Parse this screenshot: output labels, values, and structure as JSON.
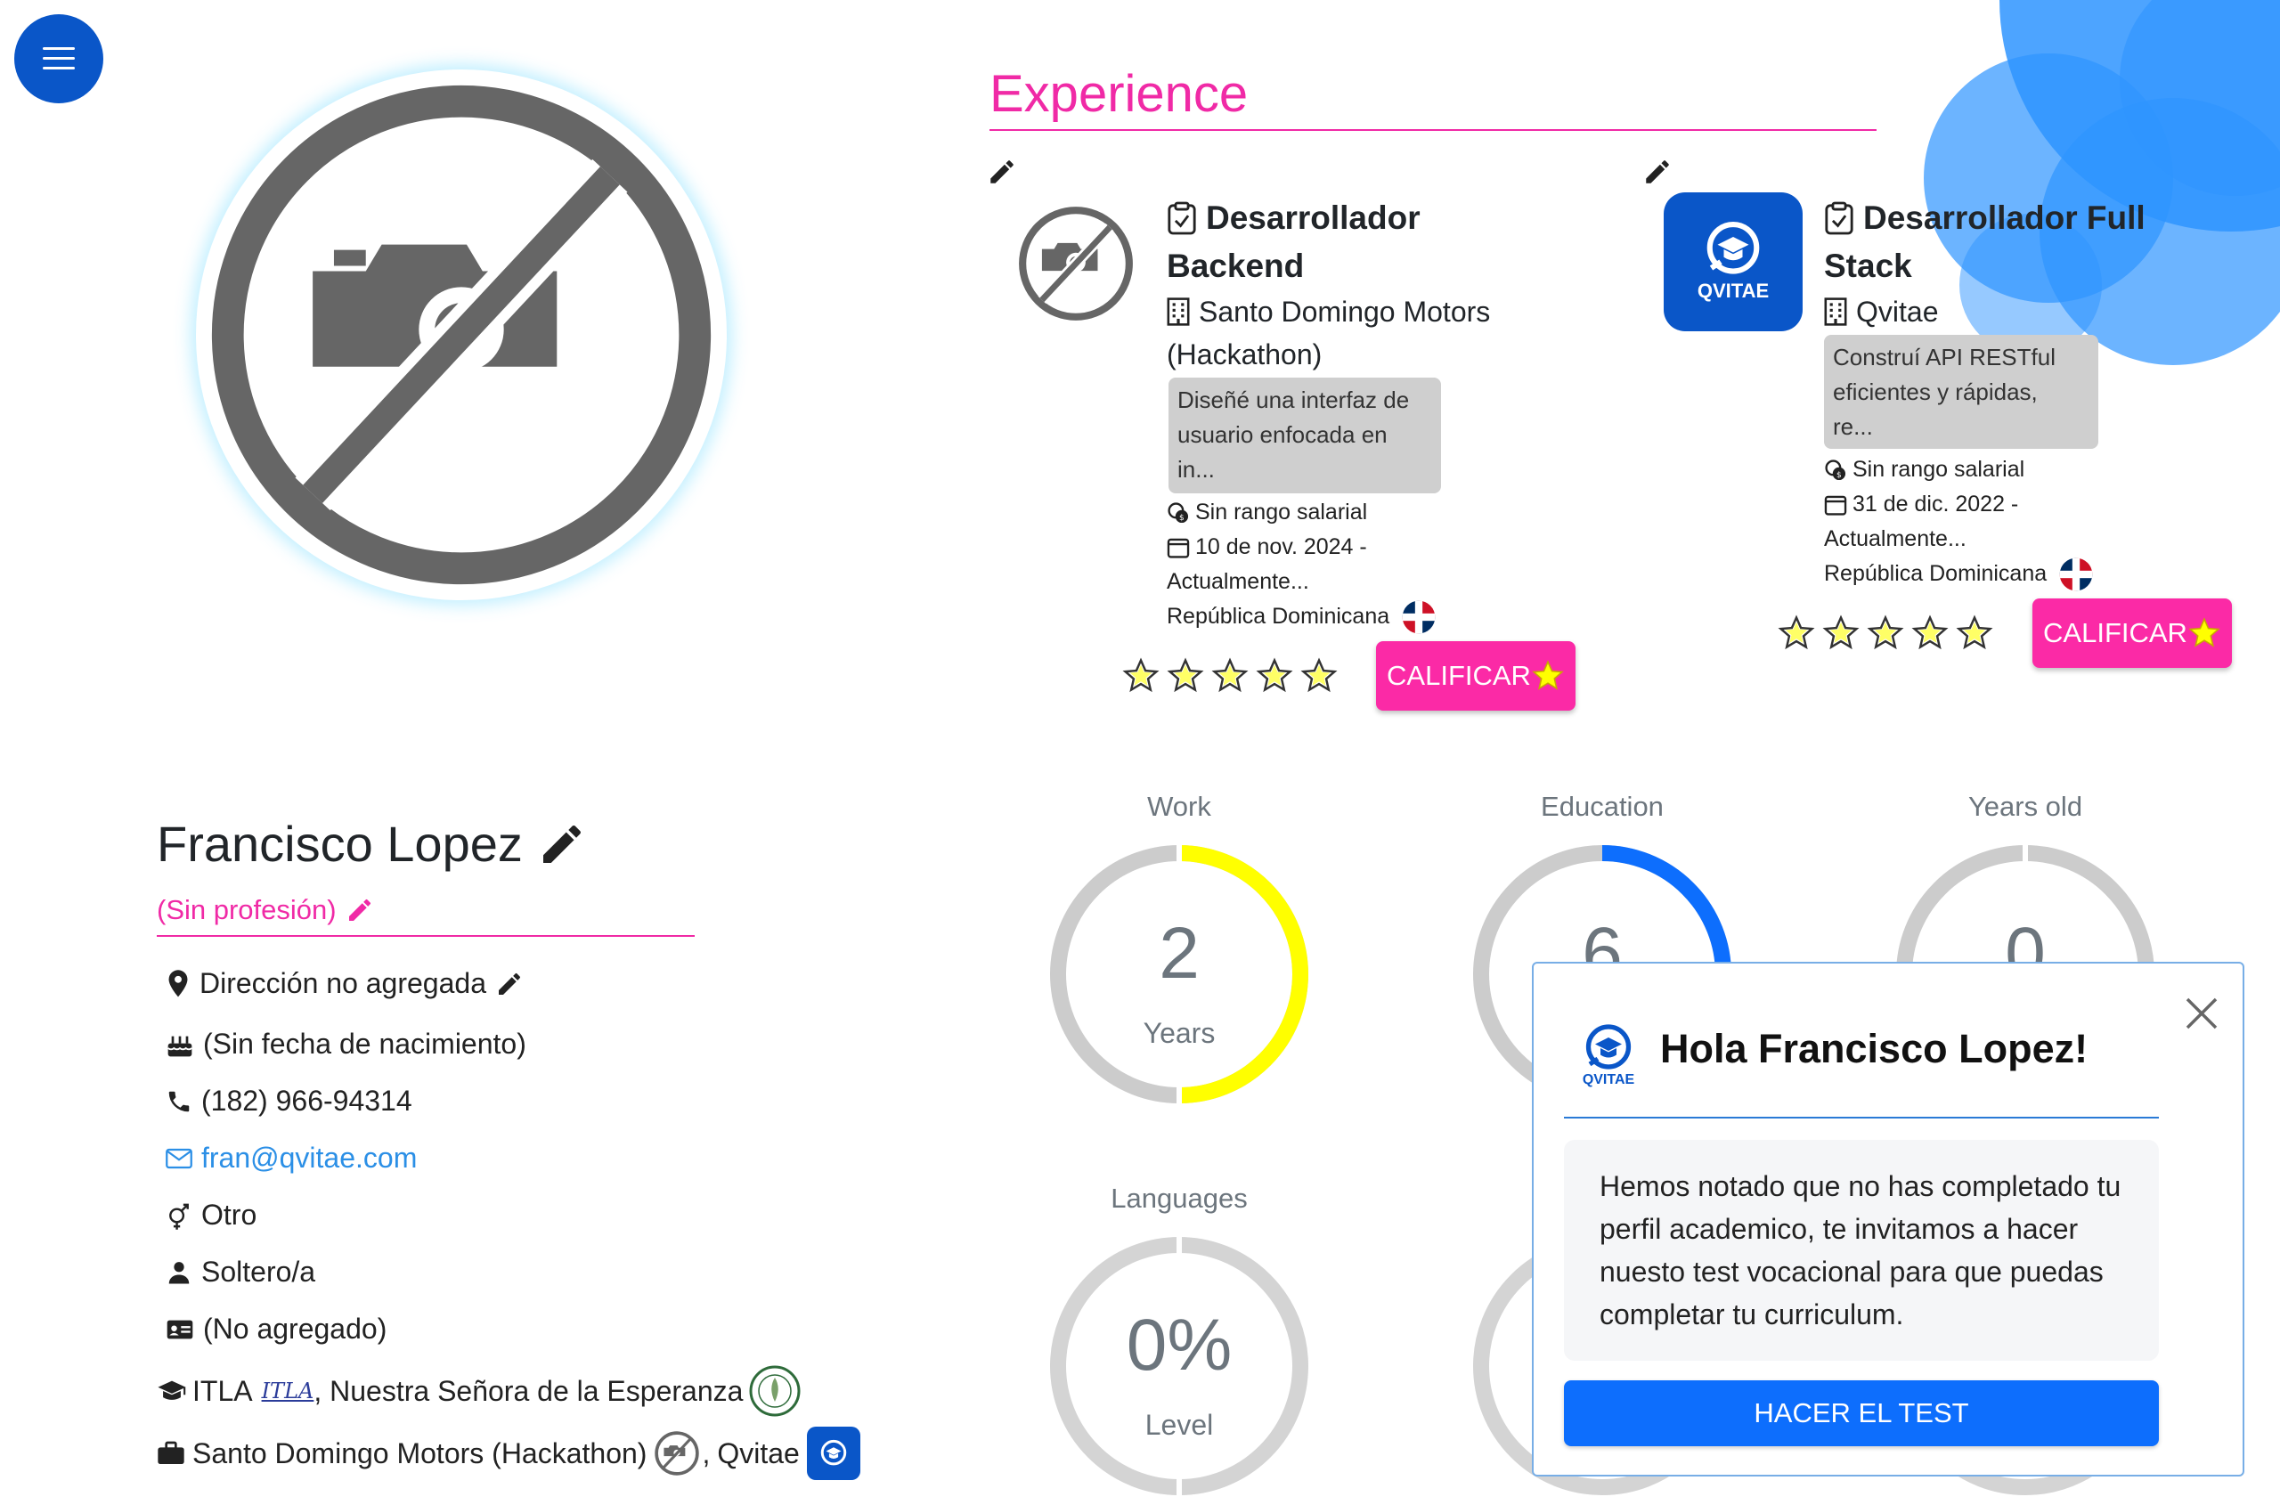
{
  "menu": {
    "icon": "hamburger-icon"
  },
  "experience": {
    "title": "Experience",
    "cards": [
      {
        "title_line1": "Desarrollador",
        "title_line2": "Backend",
        "company_line1": "Santo Domingo Motors",
        "company_line2": "(Hackathon)",
        "desc_lines": [
          "Diseñé una interfaz de",
          "usuario enfocada en",
          "in..."
        ],
        "salary": "Sin rango salarial",
        "date_line1": "10 de nov. 2024 -",
        "date_line2": "Actualmente...",
        "country": "República Dominicana",
        "rate_label": "CALIFICAR",
        "rating": 0
      },
      {
        "title_line1": "Desarrollador Full",
        "title_line2": "Stack",
        "company_line1": "Qvitae",
        "logo_text": "QVITAE",
        "desc_lines": [
          "Construí API RESTful",
          "eficientes y rápidas,",
          "re..."
        ],
        "salary": "Sin rango salarial",
        "date_line1": "31 de dic. 2022 -",
        "date_line2": "Actualmente...",
        "country": "República Dominicana",
        "rate_label": "CALIFICAR",
        "rating": 0
      }
    ]
  },
  "profile": {
    "name": "Francisco Lopez",
    "profession": "(Sin profesión)",
    "address": "Dirección no agregada",
    "birth": "(Sin fecha de nacimiento)",
    "phone": "(182) 966-94314",
    "email": "fran@qvitae.com",
    "gender": "Otro",
    "marital": "Soltero/a",
    "document": "(No agregado)",
    "education_1": "ITLA",
    "education_1_logo": "ITLA",
    "education_2": ", Nuestra Señora de la Esperanza",
    "work_1": "Santo Domingo Motors (Hackathon)",
    "work_sep": ",",
    "work_2": "Qvitae"
  },
  "stats": {
    "work": {
      "label": "Work",
      "value": "2",
      "unit": "Years",
      "fraction": 0.5,
      "color": "#ffff00"
    },
    "education": {
      "label": "Education",
      "value": "6",
      "fraction": 0.5,
      "color": "#0d6efd"
    },
    "age": {
      "label": "Years old",
      "value": "0",
      "fraction": 0,
      "color": "#cccccc"
    },
    "languages": {
      "label": "Languages",
      "value": "0%",
      "unit": "Level",
      "fraction": 0,
      "color": "#cccccc"
    }
  },
  "modal": {
    "logo_text": "QVITAE",
    "title": "Hola Francisco Lopez!",
    "body": "Hemos notado que no has completado tu perfil academico, te invitamos a hacer nuesto test vocacional para que puedas completar tu curriculum.",
    "button": "HACER EL TEST"
  }
}
